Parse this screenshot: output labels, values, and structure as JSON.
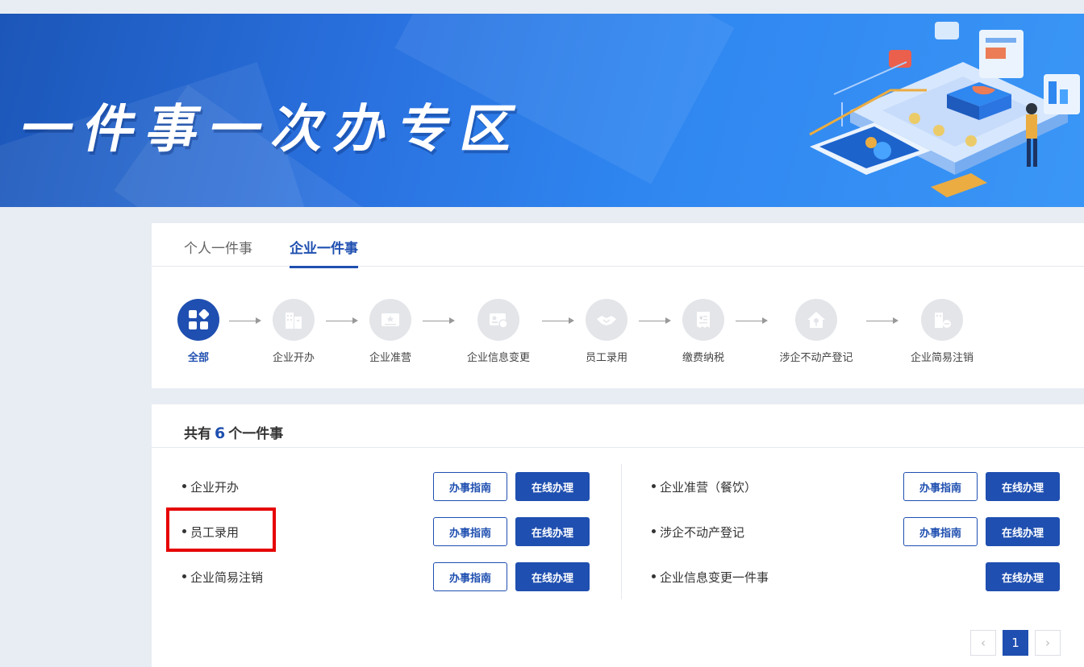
{
  "banner": {
    "title": "一件事一次办专区"
  },
  "tabs": [
    {
      "label": "个人一件事",
      "active": false
    },
    {
      "label": "企业一件事",
      "active": true
    }
  ],
  "steps": [
    {
      "label": "全部",
      "icon": "grid-icon",
      "active": true
    },
    {
      "label": "企业开办",
      "icon": "building-icon"
    },
    {
      "label": "企业准营",
      "icon": "certificate-icon"
    },
    {
      "label": "企业信息变更",
      "icon": "id-card-refresh-icon"
    },
    {
      "label": "员工录用",
      "icon": "handshake-icon"
    },
    {
      "label": "缴费纳税",
      "icon": "tax-receipt-icon"
    },
    {
      "label": "涉企不动产登记",
      "icon": "house-key-icon"
    },
    {
      "label": "企业简易注销",
      "icon": "building-minus-icon"
    }
  ],
  "summary": {
    "prefix": "共有",
    "count": "6",
    "suffix": "个一件事"
  },
  "buttons": {
    "guide": "办事指南",
    "online": "在线办理"
  },
  "items_left": [
    {
      "name": "企业开办",
      "has_guide": true
    },
    {
      "name": "员工录用",
      "has_guide": true,
      "highlighted": true
    },
    {
      "name": "企业简易注销",
      "has_guide": true
    }
  ],
  "items_right": [
    {
      "name": "企业准营（餐饮）",
      "has_guide": true
    },
    {
      "name": "涉企不动产登记",
      "has_guide": true
    },
    {
      "name": "企业信息变更一件事",
      "has_guide": false
    }
  ],
  "pagination": {
    "prev": "‹",
    "current": "1",
    "next": "›"
  },
  "colors": {
    "primary": "#1f4fb0",
    "highlight": "#e60000",
    "banner": "#2a72e0"
  }
}
